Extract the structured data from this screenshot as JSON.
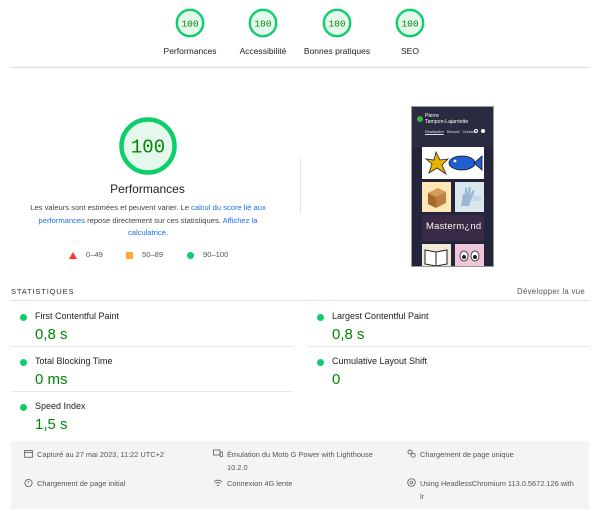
{
  "summary": {
    "gauges": [
      {
        "score": "100",
        "label": "Performances"
      },
      {
        "score": "100",
        "label": "Accessibilité"
      },
      {
        "score": "100",
        "label": "Bonnes pratiques"
      },
      {
        "score": "100",
        "label": "SEO"
      }
    ]
  },
  "performance": {
    "score": "100",
    "title": "Performances",
    "description": {
      "part1": "Les valeurs sont estimées et peuvent varier. Le ",
      "link1": "calcul du score lié aux performances",
      "part2": " repose directement sur ces statistiques. ",
      "link2": "Affichez la calculatrice",
      "part3": "."
    },
    "legend": [
      {
        "range": "0–49",
        "color": "#ff3333"
      },
      {
        "range": "50–89",
        "color": "#ffaa33"
      },
      {
        "range": "90–100",
        "color": "#0cce6b"
      }
    ]
  },
  "thumbnail": {
    "site_name_line1": "Pierre",
    "site_name_line2": "Tampon-Lajarriette",
    "nav": [
      "Réalisation",
      "Recueil",
      "Contact"
    ],
    "banner_text": "Masterm¿nd"
  },
  "stats": {
    "title": "STATISTIQUES",
    "expand_label": "Développer la vue",
    "metrics": [
      {
        "name": "First Contentful Paint",
        "value": "0,8 s"
      },
      {
        "name": "Largest Contentful Paint",
        "value": "0,8 s"
      },
      {
        "name": "Total Blocking Time",
        "value": "0 ms"
      },
      {
        "name": "Cumulative Layout Shift",
        "value": "0"
      },
      {
        "name": "Speed Index",
        "value": "1,5 s"
      }
    ]
  },
  "runtime": {
    "captured": "Capturé au 27 mai 2023, 11:22 UTC+2",
    "emulation_line1": "Émulation du Moto G Power with Lighthouse",
    "emulation_line2": "10.2.0",
    "single_load": "Chargement de page unique",
    "initial_load": "Chargement de page initial",
    "network": "Connexion 4G lente",
    "browser_line1": "Using HeadlessChromium 113.0.5672.126 with",
    "browser_line2": "lr"
  },
  "colors": {
    "pass_green": "#0cce6b",
    "pass_text": "#008800",
    "link_blue": "#1a73e8"
  }
}
